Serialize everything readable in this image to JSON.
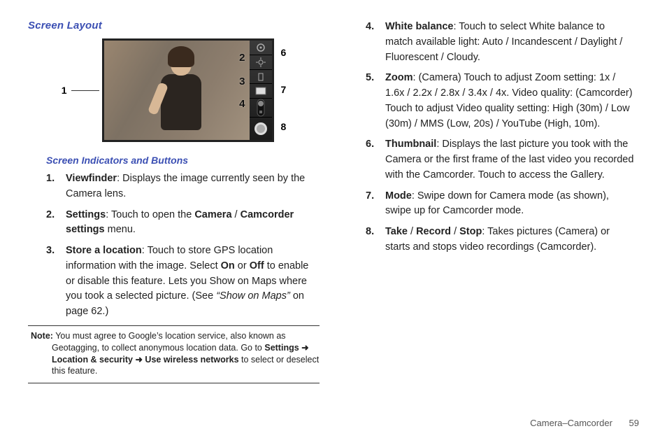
{
  "section_title": "Screen Layout",
  "subsection_title": "Screen Indicators and Buttons",
  "diagram": {
    "labels": {
      "n1": "1",
      "n2": "2",
      "n3": "3",
      "n4": "4",
      "n6": "6",
      "n7": "7",
      "n8": "8"
    },
    "sidebar_icons": [
      "gear",
      "gps",
      "zoom",
      "blank",
      "mode-switch",
      "shutter"
    ]
  },
  "left_list": [
    {
      "num": "1.",
      "term": "Viewfinder",
      "text": ": Displays the image currently seen by the Camera lens."
    },
    {
      "num": "2.",
      "term": "Settings",
      "text_a": ": Touch to open the ",
      "bold_a": "Camera",
      "sep": " / ",
      "bold_b": "Camcorder settings",
      "text_b": " menu."
    },
    {
      "num": "3.",
      "term": "Store a location",
      "text_a": ": Touch to store GPS location information with the image. Select ",
      "bold_a": "On",
      "or": " or ",
      "bold_b": "Off",
      "text_b": " to enable or disable this feature. Lets you Show on Maps where you took a selected picture. (See ",
      "ital": "“Show on Maps”",
      "text_c": " on page 62.)"
    }
  ],
  "note": {
    "label": "Note:",
    "text_a": " You must agree to Google’s location service, also known as Geotagging, to collect anonymous location data. Go to ",
    "bold_a": "Settings",
    "arrow": " ➜ ",
    "bold_b": "Location & security",
    "bold_c": "Use wireless networks",
    "text_b": " to select or deselect this feature."
  },
  "right_list": [
    {
      "num": "4.",
      "term": "White balance",
      "text": ": Touch to select White balance to match available light: Auto / Incandescent / Daylight / Fluorescent / Cloudy."
    },
    {
      "num": "5.",
      "term": "Zoom",
      "text": ": (Camera) Touch to adjust Zoom setting: 1x / 1.6x / 2.2x / 2.8x / 3.4x / 4x. Video quality: (Camcorder) Touch to adjust Video quality setting: High (30m) / Low (30m) / MMS (Low, 20s) / YouTube (High, 10m)."
    },
    {
      "num": "6.",
      "term": "Thumbnail",
      "text": ": Displays the last picture you took with the Camera or the first frame of the last video you recorded with the Camcorder. Touch to access the Gallery."
    },
    {
      "num": "7.",
      "term": "Mode",
      "text": ": Swipe down for Camera mode (as shown), swipe up for Camcorder mode."
    },
    {
      "num": "8.",
      "term": "Take",
      "sep1": " / ",
      "term2": "Record",
      "sep2": " / ",
      "term3": "Stop",
      "text": ": Takes pictures (Camera) or starts and stops video recordings (Camcorder)."
    }
  ],
  "footer": {
    "section": "Camera–Camcorder",
    "page": "59"
  }
}
